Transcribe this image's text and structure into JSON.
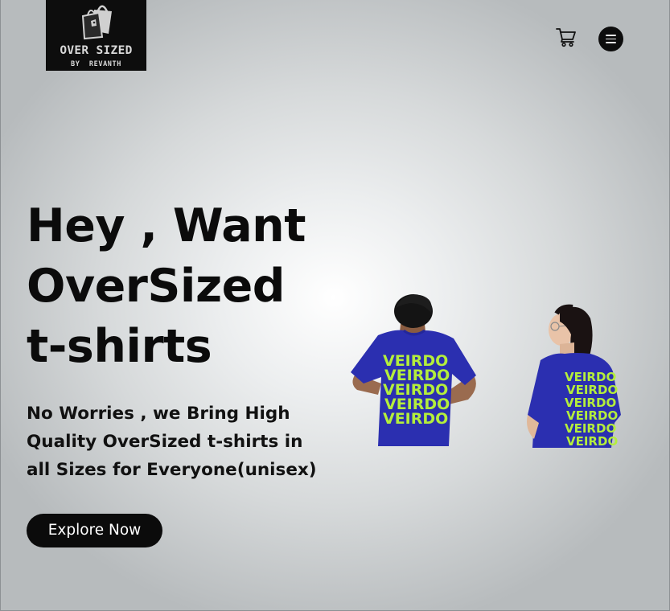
{
  "header": {
    "logo": {
      "title": "OVER SIZED",
      "subtitle": "BY  REVANTH"
    },
    "cart_icon": "shopping-cart-icon",
    "menu_icon": "hamburger-menu-icon"
  },
  "hero": {
    "title_lines": [
      "Hey , Want",
      "OverSized",
      "t-shirts"
    ],
    "subtitle_lines": [
      "No Worries , we Bring High",
      "Quality OverSized t-shirts in",
      "all Sizes for Everyone(unisex)"
    ],
    "cta_label": "Explore Now"
  },
  "products": {
    "shirt_print": "VEIRDO"
  },
  "colors": {
    "text": "#0b0b0b",
    "button_bg": "#0b0b0b",
    "button_text": "#ffffff",
    "shirt_blue": "#2b2fb0",
    "print_green": "#b4ee3c"
  }
}
